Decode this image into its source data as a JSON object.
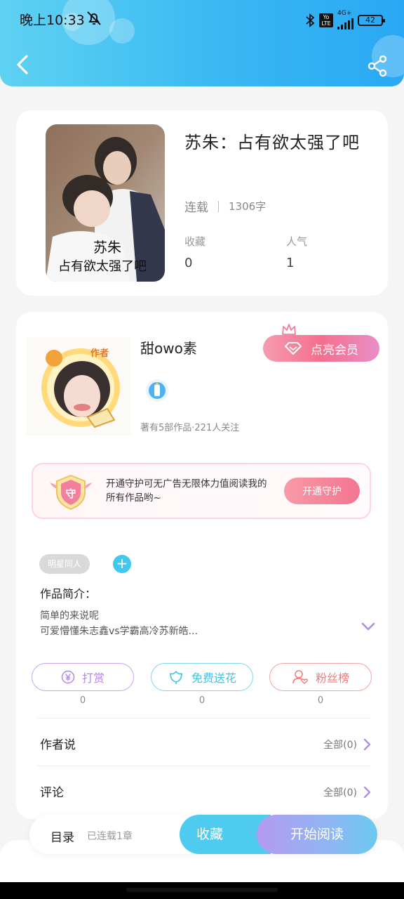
{
  "status_bar": {
    "time": "晚上10:33",
    "network": "4G+",
    "volte": "Yo LTE",
    "battery": "42"
  },
  "book": {
    "title": "苏朱：占有欲太强了吧",
    "cover_text_line1": "苏朱",
    "cover_text_line2": "占有欲太强了吧",
    "status": "连载",
    "word_count": "1306字",
    "favorites_label": "收藏",
    "favorites_value": "0",
    "popularity_label": "人气",
    "popularity_value": "1"
  },
  "author": {
    "name": "甜owo素",
    "avatar_badge": "作者",
    "meta": "著有5部作品·221人关注",
    "vip_label": "点亮会员"
  },
  "guard": {
    "icon_char": "守",
    "text": "开通守护可无广告无限体力值阅读我的所有作品哟~",
    "button": "开通守护"
  },
  "tags": {
    "items": [
      "明星同人"
    ],
    "add_symbol": "+"
  },
  "intro": {
    "title": "作品简介：",
    "line1": "简单的来说呢",
    "line2": "可爱懵懂朱志鑫vs学霸高冷苏新皓..."
  },
  "actions": [
    {
      "label": "打赏",
      "count": "0",
      "color": "#b388e8",
      "icon": "yen-coin-icon"
    },
    {
      "label": "免费送花",
      "count": "0",
      "color": "#3fc3ea",
      "icon": "flower-icon"
    },
    {
      "label": "粉丝榜",
      "count": "0",
      "color": "#f07b7b",
      "icon": "fan-user-icon"
    }
  ],
  "sections": {
    "author_says": {
      "title": "作者说",
      "link": "全部(0)"
    },
    "comments": {
      "title": "评论",
      "link": "全部(0)"
    }
  },
  "bottom_bar": {
    "toc": "目录",
    "toc_status": "已连载1章",
    "favorite": "收藏",
    "read": "开始阅读"
  },
  "colors": {
    "header_start": "#5fd2f2",
    "header_end": "#2aa8f5",
    "accent_pink": "#f37591",
    "accent_blue": "#42c8ef"
  }
}
